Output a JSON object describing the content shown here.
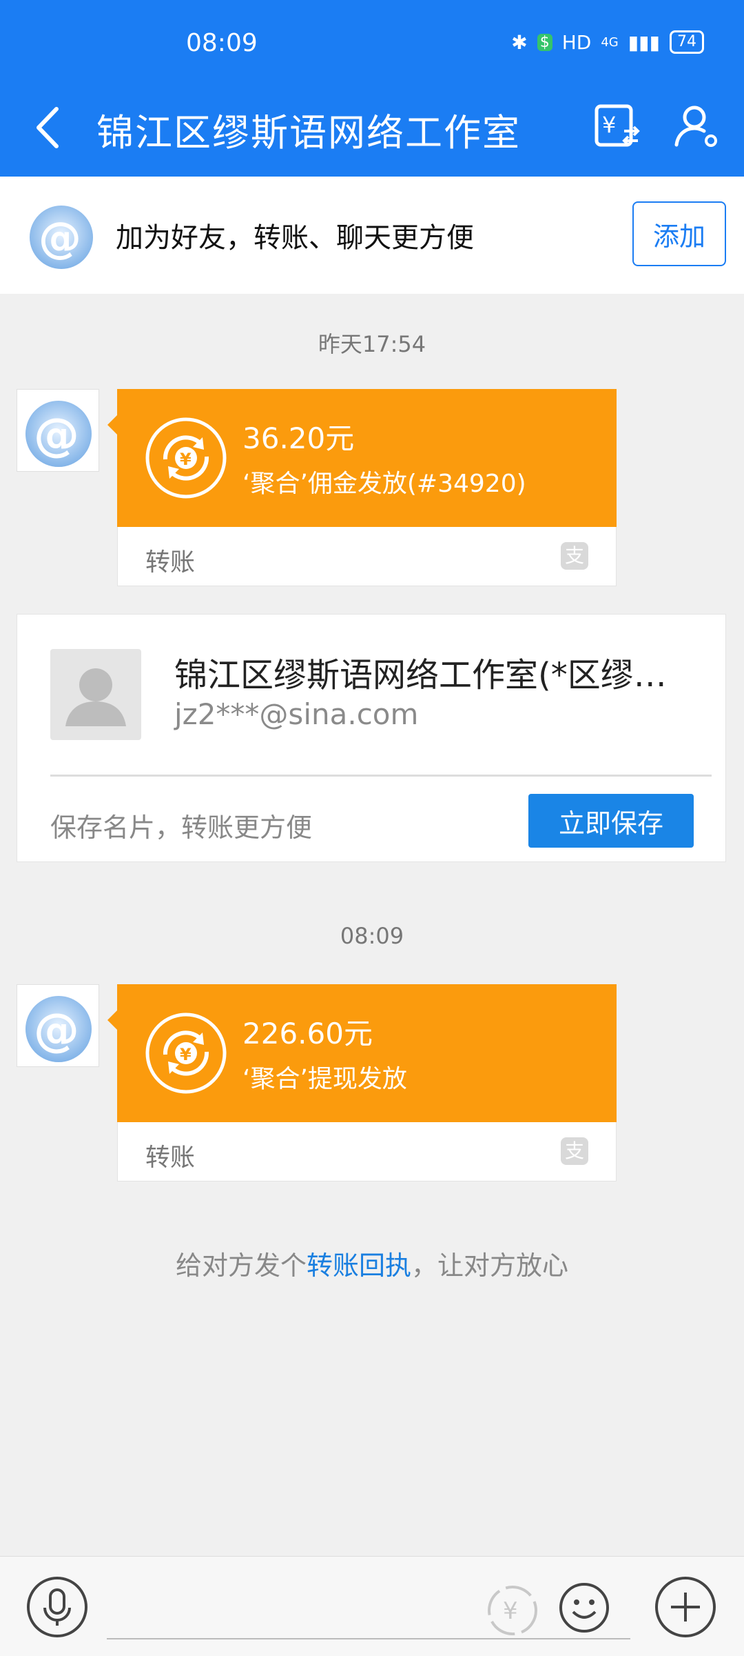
{
  "status_bar": {
    "time": "08:09",
    "network": "HD",
    "signal": "4G",
    "battery": "74"
  },
  "header": {
    "title": "锦江区缪斯语网络工作室"
  },
  "friend_banner": {
    "text": "加为好友，转账、聊天更方便",
    "add_label": "添加"
  },
  "messages": [
    {
      "timestamp": "昨天17:54",
      "amount": "36.20元",
      "description": "‘聚合’佣金发放(#34920)",
      "type_label": "转账"
    },
    {
      "timestamp": "08:09",
      "amount": "226.60元",
      "description": "‘聚合’提现发放",
      "type_label": "转账"
    }
  ],
  "contact_card": {
    "name": "锦江区缪斯语网络工作室(*区缪…",
    "email": "jz2***@sina.com",
    "hint": "保存名片，转账更方便",
    "save_label": "立即保存"
  },
  "receipt_tip": {
    "prefix": "给对方发个",
    "link": "转账回执",
    "suffix": "，让对方放心"
  },
  "colors": {
    "brand_blue": "#1b7df3",
    "transfer_orange": "#fb9b0d",
    "background": "#f0f0f0"
  },
  "icons": [
    "back-icon",
    "transfer-icon",
    "profile-icon",
    "mic-icon",
    "yuan-icon",
    "emoji-icon",
    "plus-icon",
    "alipay-icon"
  ]
}
